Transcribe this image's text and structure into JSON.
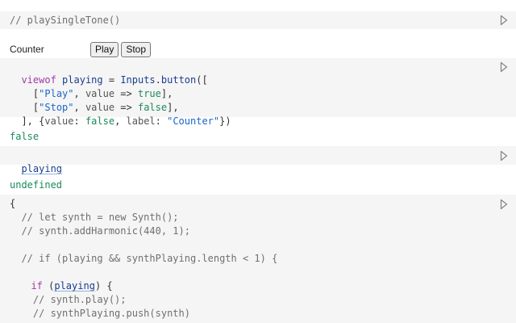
{
  "cells": {
    "tone": {
      "comment": "// playSingleTone()"
    },
    "counter": {
      "label": "Counter",
      "buttons": [
        "Play",
        "Stop"
      ],
      "lines": [
        [
          "viewof",
          " ",
          "playing",
          " = ",
          "Inputs",
          ".",
          "button",
          "(["
        ],
        [
          "  [",
          "\"Play\"",
          ", ",
          "value",
          " => ",
          "true",
          "],"
        ],
        [
          "  [",
          "\"Stop\"",
          ", ",
          "value",
          " => ",
          "false",
          "],"
        ],
        [
          "], {",
          "value",
          ": ",
          "false",
          ", ",
          "label",
          ": ",
          "\"Counter\"",
          "})"
        ]
      ]
    },
    "playing": {
      "output": "false",
      "name": "playing"
    },
    "synth": {
      "output": "undefined",
      "lines": {
        "open": "{",
        "c1": "  // let synth = new Synth();",
        "c2": "  // synth.addHarmonic(440, 1);",
        "c3": "  // if (playing && synthPlaying.length < 1) {",
        "if_kw": "if",
        "if_open": " (",
        "if_ref": "playing",
        "if_close": ") {",
        "c4": "    // synth.play();",
        "c5": "    // synthPlaying.push(synth)"
      }
    }
  },
  "icons": {
    "run": "play-triangle-icon"
  },
  "colors": {
    "cell_bg": "#f5f5f5",
    "output_value": "#1b8a5a",
    "keyword": "#a33aa8",
    "string": "#1a66c9",
    "reference": "#1a3e8e",
    "comment": "#6f6f6f"
  }
}
